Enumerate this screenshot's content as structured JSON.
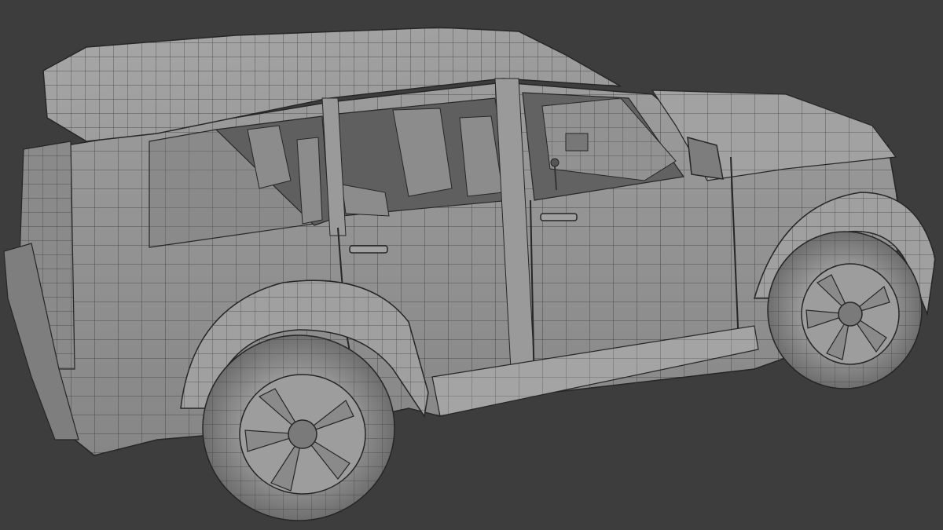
{
  "viewport": {
    "background": "#3d3d3d",
    "model": "suv-wireframe-mesh"
  },
  "colors": {
    "body": "#8e8e8e",
    "body_light": "#a6a6a6",
    "body_dark": "#6c6c6c",
    "interior": "#5f5f5f",
    "wire": "#262626",
    "tire": "#7a7a7a",
    "rim": "#9a9a9a"
  }
}
